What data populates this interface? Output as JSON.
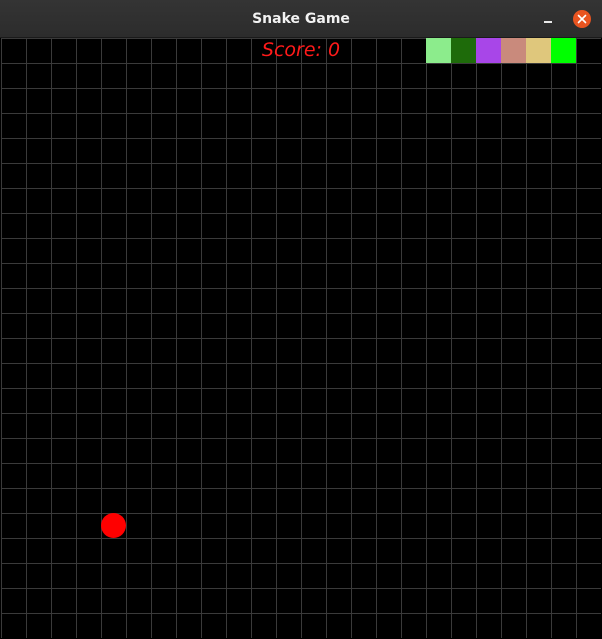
{
  "window": {
    "title": "Snake Game",
    "close_icon": "close-icon",
    "minimize_icon": "minimize-icon"
  },
  "game": {
    "score_text": "Score: 0",
    "grid": {
      "columns": 24,
      "rows": 24
    },
    "snake": [
      {
        "col": 17,
        "row": 0,
        "color": "#8cec8c"
      },
      {
        "col": 18,
        "row": 0,
        "color": "#1e6b0a"
      },
      {
        "col": 19,
        "row": 0,
        "color": "#a846e8"
      },
      {
        "col": 20,
        "row": 0,
        "color": "#c98a7c"
      },
      {
        "col": 21,
        "row": 0,
        "color": "#dfc77c"
      },
      {
        "col": 22,
        "row": 0,
        "color": "#00ff00"
      }
    ],
    "food": {
      "col": 4,
      "row": 19,
      "color": "#ff0000"
    }
  }
}
